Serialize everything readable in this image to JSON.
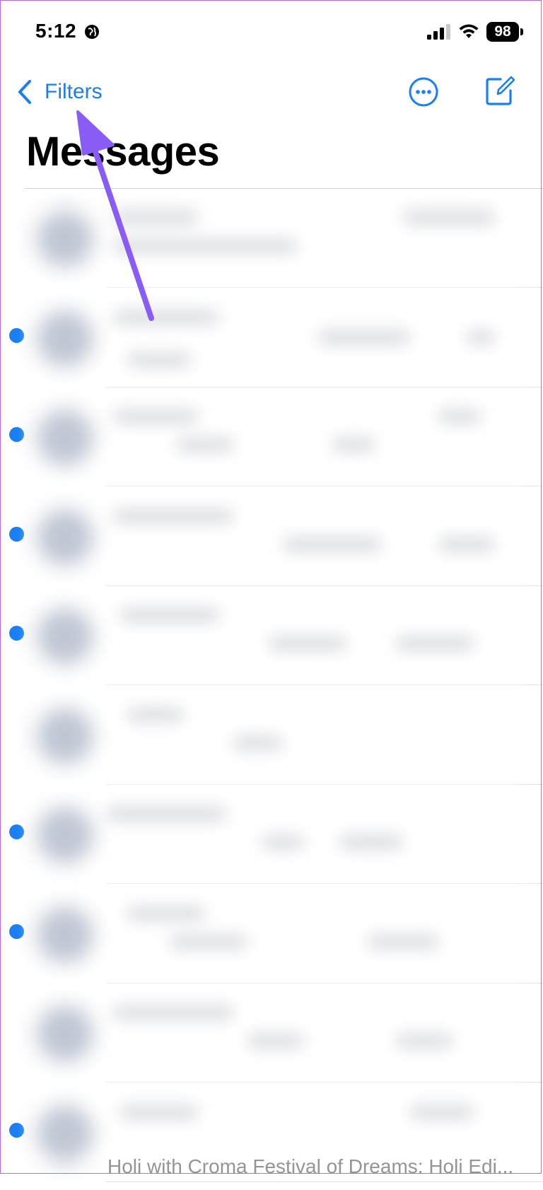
{
  "status_bar": {
    "time": "5:12",
    "battery_level": "98",
    "icons": [
      "globe-icon",
      "signal-icon",
      "wifi-icon",
      "battery-icon"
    ]
  },
  "nav": {
    "back_label": "Filters",
    "back_icon": "chevron-left-icon",
    "more_icon": "ellipsis-circle-icon",
    "compose_icon": "compose-icon"
  },
  "page_title": "Messages",
  "accent_color": "#1a7ff2",
  "annotation_color": "#8a5cf6",
  "messages": [
    {
      "unread": false
    },
    {
      "unread": true
    },
    {
      "unread": true
    },
    {
      "unread": true
    },
    {
      "unread": true
    },
    {
      "unread": false
    },
    {
      "unread": true
    },
    {
      "unread": true
    },
    {
      "unread": false
    },
    {
      "unread": true,
      "preview": "Holi with Croma Festival of Dreams: Holi Edi..."
    }
  ]
}
